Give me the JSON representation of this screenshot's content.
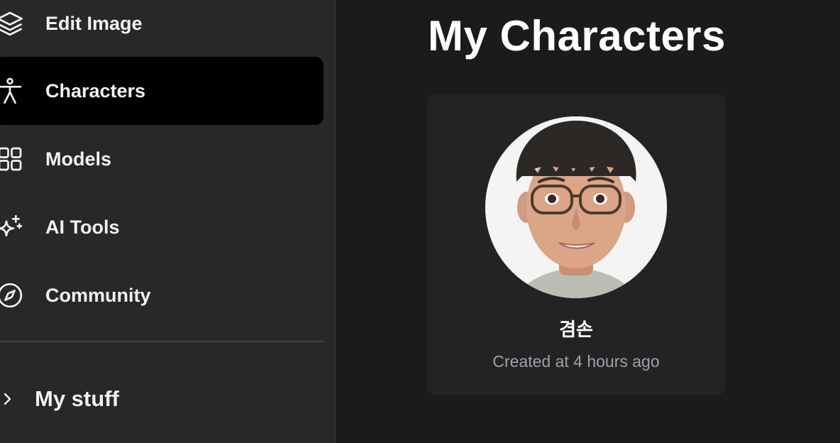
{
  "sidebar": {
    "items": [
      {
        "label": "Edit Image",
        "icon": "layers-icon",
        "active": false
      },
      {
        "label": "Characters",
        "icon": "person-icon",
        "active": true
      },
      {
        "label": "Models",
        "icon": "grid-icon",
        "active": false
      },
      {
        "label": "AI Tools",
        "icon": "sparkles-icon",
        "active": false
      },
      {
        "label": "Community",
        "icon": "compass-icon",
        "active": false
      }
    ],
    "my_stuff": {
      "label": "My stuff",
      "icon": "chevron-right-icon"
    }
  },
  "main": {
    "title": "My Characters",
    "characters": [
      {
        "name": "겸손",
        "created": "Created at 4 hours ago"
      }
    ]
  },
  "colors": {
    "sidebar_bg": "#282828",
    "main_bg": "#1b1b1b",
    "active_item_bg": "#000000",
    "card_bg": "#232323",
    "meta_text": "#9aa2ad"
  }
}
